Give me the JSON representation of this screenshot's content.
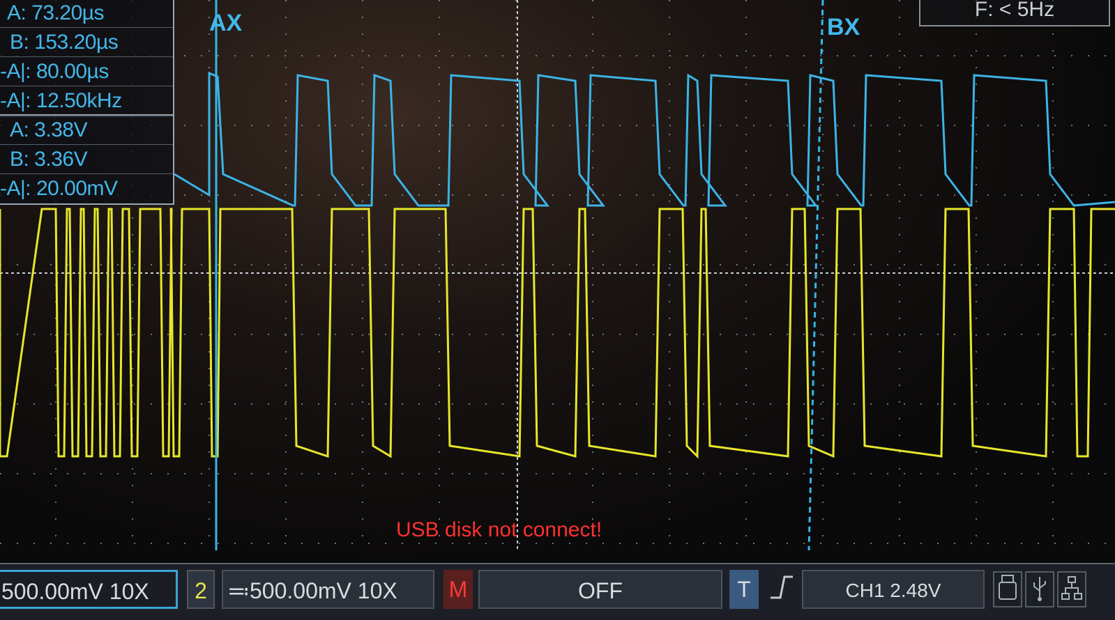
{
  "cursor_time": {
    "rows": [
      "A: 73.20µs",
      "B: 153.20µs",
      "-A|: 80.00µs",
      "-A|: 12.50kHz"
    ]
  },
  "cursor_volt": {
    "rows": [
      "A: 3.38V",
      "B: 3.36V",
      "-A|: 20.00mV"
    ]
  },
  "cursor_labels": {
    "a": "AX",
    "b": "BX"
  },
  "frequency": "F: < 5Hz",
  "message": "USB disk not connect!",
  "statusbar": {
    "ch1_scale": "500.00mV  10X",
    "ch2_number": "2",
    "ch2_scale": "≕500.00mV  10X",
    "math_icon": "M",
    "math_state": "OFF",
    "trigger_icon": "T",
    "trigger_slope_icon": "rising-edge-icon",
    "trigger_info": "CH1 2.48V"
  },
  "colors": {
    "ch1": "#e6e62a",
    "ch2": "#3cb4e6",
    "cursor": "#33b8ea",
    "message": "#ff3030"
  },
  "icons": [
    "usb-disk-icon",
    "usb-icon",
    "network-icon"
  ]
}
